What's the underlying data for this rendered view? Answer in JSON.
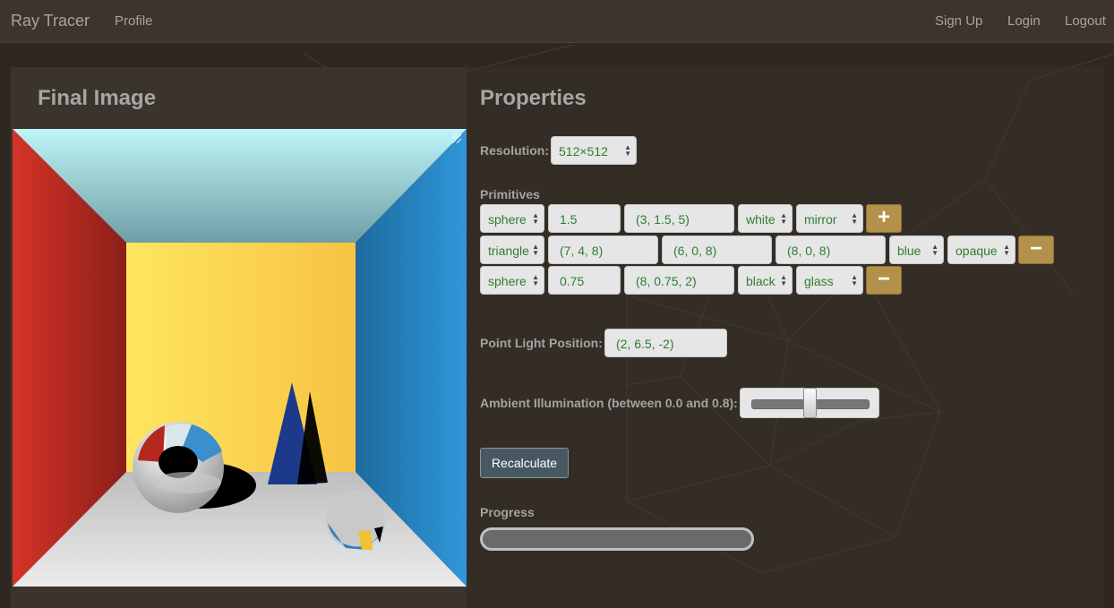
{
  "navbar": {
    "brand": "Ray Tracer",
    "profile": "Profile",
    "signup": "Sign Up",
    "login": "Login",
    "logout": "Logout"
  },
  "left_panel": {
    "title": "Final Image"
  },
  "properties": {
    "title": "Properties",
    "resolution_label": "Resolution:",
    "resolution_value": "512×512",
    "primitives_label": "Primitives",
    "primitives": [
      {
        "type": "sphere",
        "radius": "1.5",
        "center": "(3, 1.5, 5)",
        "color": "white",
        "material": "mirror",
        "action": "+"
      },
      {
        "type": "triangle",
        "v1": "(7, 4, 8)",
        "v2": "(6, 0, 8)",
        "v3": "(8, 0, 8)",
        "color": "blue",
        "material": "opaque",
        "action": "−"
      },
      {
        "type": "sphere",
        "radius": "0.75",
        "center": "(8, 0.75, 2)",
        "color": "black",
        "material": "glass",
        "action": "−"
      }
    ],
    "light_label": "Point Light Position:",
    "light_value": "(2, 6.5, -2)",
    "ambient_label": "Ambient Illumination (between 0.0 and 0.8):",
    "ambient_value": 0.4,
    "ambient_range": [
      0.0,
      0.8
    ],
    "recalculate": "Recalculate",
    "progress_label": "Progress",
    "progress_value": 0
  },
  "colors": {
    "field_text": "#2e7d32",
    "button_gold": "#b4914a",
    "recalc_button": "#485863"
  },
  "icons": [
    "resize-icon",
    "select-arrows-icon",
    "plus-icon",
    "minus-icon"
  ]
}
